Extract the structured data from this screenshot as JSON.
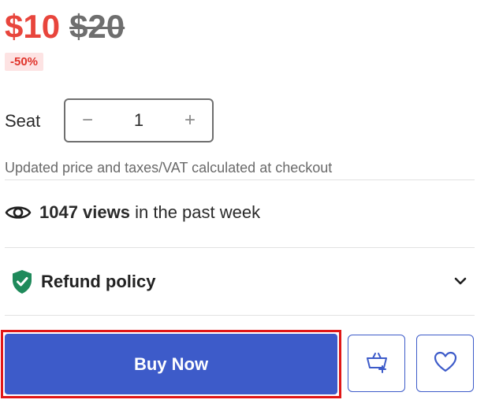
{
  "price": {
    "current": "$10",
    "original": "$20",
    "discount": "-50%"
  },
  "seat": {
    "label": "Seat",
    "decrement": "−",
    "value": "1",
    "increment": "+"
  },
  "checkout_note": "Updated price and taxes/VAT calculated at checkout",
  "views": {
    "count": "1047 views",
    "suffix": "in the past week",
    "icon": "eye-icon"
  },
  "refund": {
    "label": "Refund policy",
    "icon": "shield-check-icon",
    "expand_icon": "chevron-down-icon"
  },
  "actions": {
    "buy_now": "Buy Now",
    "add_to_basket_icon": "basket-add-icon",
    "wishlist_icon": "heart-icon"
  },
  "colors": {
    "price_red": "#e8453c",
    "primary_blue": "#3d5bc9",
    "shield_green": "#1f8a5b",
    "highlight_red": "#e01717"
  }
}
